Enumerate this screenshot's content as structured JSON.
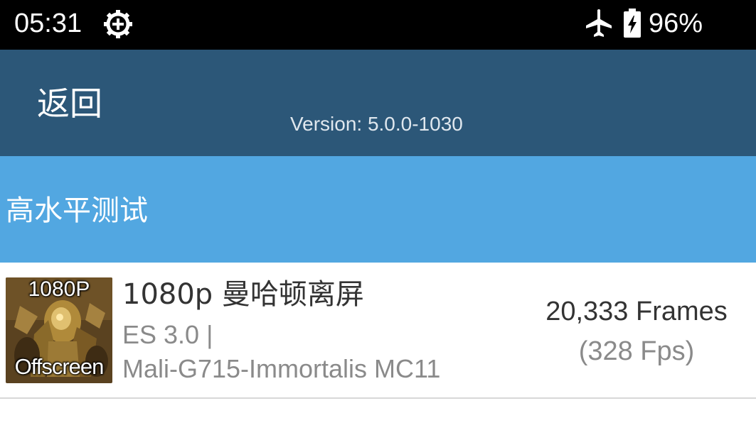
{
  "status_bar": {
    "time": "05:31",
    "battery_percent": "96%",
    "icons": [
      "settings-gear-icon",
      "airplane-mode-icon",
      "battery-charging-icon"
    ]
  },
  "app_bar": {
    "back_label": "返回",
    "version": "Version: 5.0.0-1030",
    "background": "#2c5778"
  },
  "section": {
    "title": "高水平测试",
    "background": "#52a7e1"
  },
  "tests": [
    {
      "thumbnail": {
        "top_label": "1080P",
        "bottom_label": "Offscreen",
        "icon": "manhattan-robot-thumbnail"
      },
      "name": "1080p 曼哈顿离屏",
      "api": "ES 3.0 |",
      "gpu": "Mali-G715-Immortalis MC11",
      "frames": "20,333 Frames",
      "fps": "(328 Fps)"
    }
  ]
}
